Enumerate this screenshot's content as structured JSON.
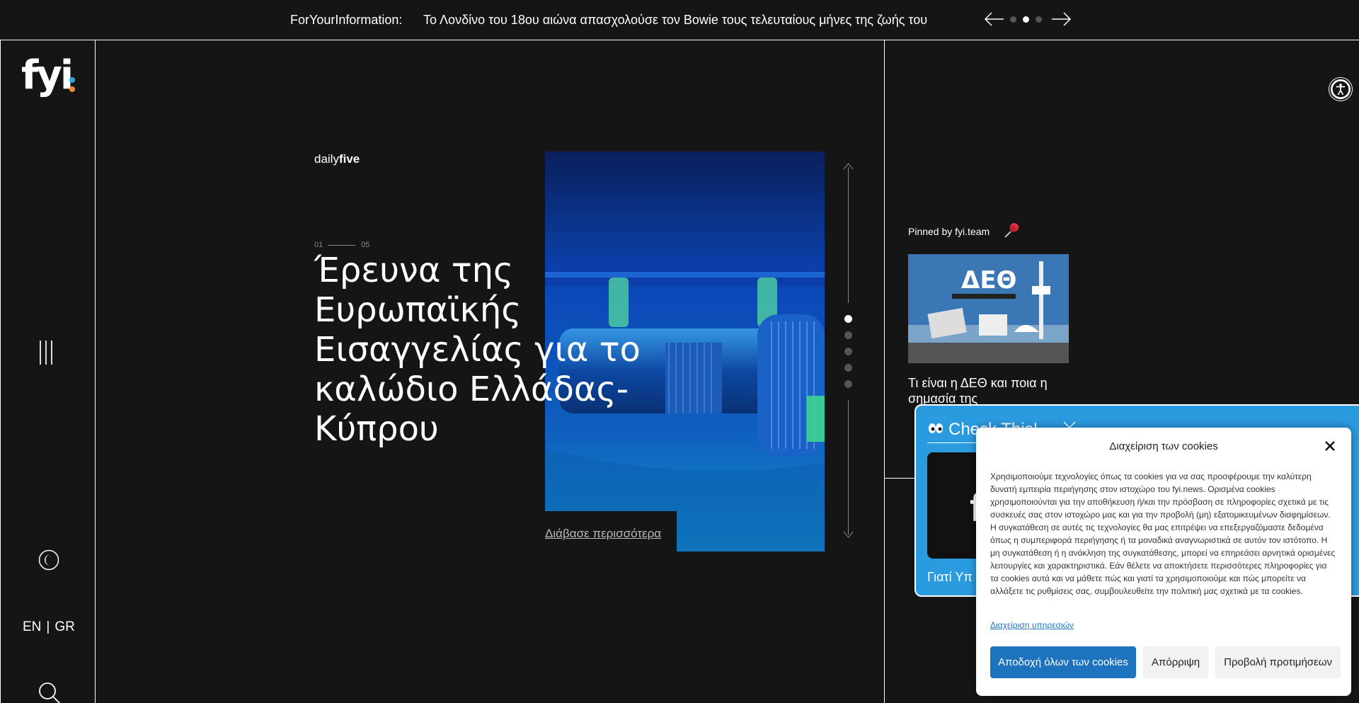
{
  "ticker": {
    "label": "ForYourInformation:",
    "headline": "Το Λονδίνο του 18ου αιώνα απασχολούσε τον Bowie τους τελευταίους μήνες της ζωής του",
    "dots_total": 3,
    "dots_active": 2
  },
  "sidebar": {
    "logo_text": "fyi",
    "lang_en": "EN",
    "lang_sep": "|",
    "lang_gr": "GR",
    "accent_blue": "#29a6e3",
    "accent_orange": "#f28b30"
  },
  "hero": {
    "brand_light": "daily",
    "brand_bold": "five",
    "counter_current": "01",
    "counter_total": "05",
    "title": "Έρευνα της Ευρωπαϊκής Εισαγγελίας για το καλώδιο Ελλάδας-Κύπρου",
    "read_more": "Διάβασε περισσότερα",
    "slides_total": 5,
    "slides_active": 1
  },
  "pinned": {
    "label": "Pinned by fyi.team",
    "title": "Τι είναι η ΔΕΘ και ποια η σημασία της",
    "image_text": "ΔΕΘ"
  },
  "check_widget": {
    "title": "Check This!",
    "caption": "Γιατί Υπ"
  },
  "cookie": {
    "title": "Διαχείριση των cookies",
    "body": "Χρησιμοποιούμε τεχνολογίες όπως τα cookies για να σας προσφέρουμε την καλύτερη δυνατή εμπειρία περιήγησης στον ιστοχώρο του fyi.news. Ορισμένα cookies χρησιμοποιούνται για την αποθήκευση ή/και την πρόσβαση σε πληροφορίες σχετικά με τις συσκευές σας στον ιστοχώρο μας και για την προβολή (μη) εξατομικευμένων διαφημίσεων. Η συγκατάθεση σε αυτές τις τεχνολογίες θα μας επιτρέψει να επεξεργαζόμαστε δεδομένα όπως η συμπεριφορά περιήγησης ή τα μοναδικά αναγνωριστικά σε αυτόν τον ιστότοπο. Η μη συγκατάθεση ή η ανάκληση της συγκατάθεσης, μπορεί να επηρεάσει αρνητικά ορισμένες λειτουργίες και χαρακτηριστικά. Εάν θέλετε να αποκτήσετε περισσότερες πληροφορίες για τα cookies αυτά και να μάθετε πώς και γιατί τα χρησιμοποιούμε και πώς μπορείτε να αλλάξετε τις ρυθμίσεις σας, συμβουλευθείτε την πολιτική μας σχετικά με τα cookies.",
    "manage_link": "Διαχείριση υπηρεσιών",
    "accept_all": "Αποδοχή όλων των cookies",
    "reject": "Απόρριψη",
    "preferences": "Προβολή προτιμήσεων",
    "primary_color": "#1e73be"
  }
}
